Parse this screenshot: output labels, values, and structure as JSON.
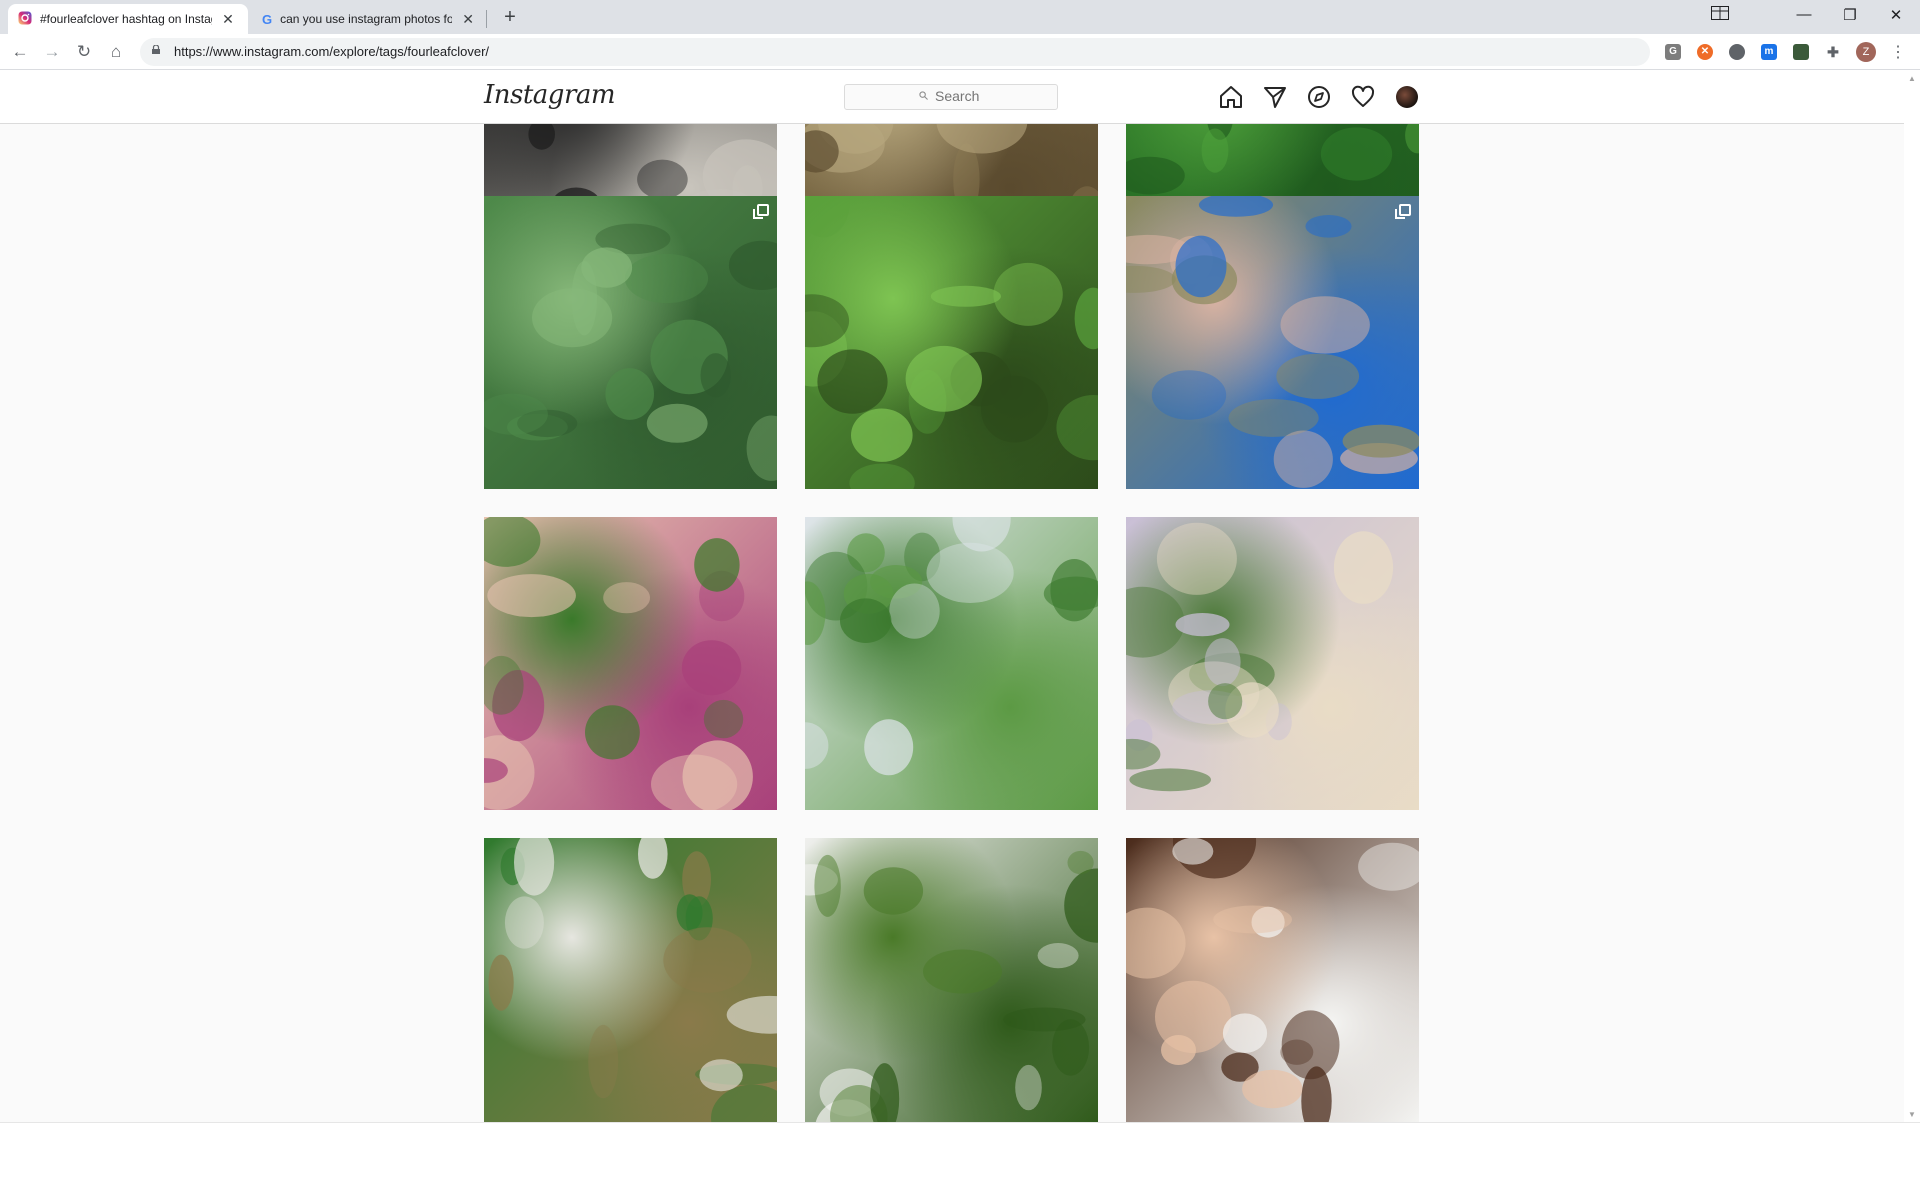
{
  "browser": {
    "tabs": [
      {
        "title": "#fourleafclover hashtag on Instagram",
        "favicon": "instagram-icon",
        "active": true
      },
      {
        "title": "can you use instagram photos for",
        "favicon": "google-icon",
        "active": false
      }
    ],
    "url": "https://www.instagram.com/explore/tags/fourleafclover/",
    "profile_initial": "Z"
  },
  "instagram": {
    "logo": "Instagram",
    "search_placeholder": "Search",
    "nav_icons": [
      "home-icon",
      "direct-icon",
      "explore-icon",
      "activity-heart-icon",
      "profile-avatar"
    ]
  },
  "grid": {
    "rows": [
      [
        {
          "name": "post-partial-1",
          "palette": [
            "#1a1a1a",
            "#2b2b2b",
            "#c9c5bd"
          ],
          "multi": false
        },
        {
          "name": "post-partial-2",
          "palette": [
            "#8c7a52",
            "#b7a77e",
            "#5a4a2e"
          ],
          "multi": false
        },
        {
          "name": "post-partial-3",
          "palette": [
            "#2f7d2a",
            "#4ea03b",
            "#1f5a1e"
          ],
          "multi": false
        }
      ],
      [
        {
          "name": "post-clover-patch",
          "palette": [
            "#4e8a4a",
            "#87b87a",
            "#2f5a2e"
          ],
          "multi": true
        },
        {
          "name": "post-clover-leaves",
          "palette": [
            "#5aa23c",
            "#7ec452",
            "#2c4a1a"
          ],
          "multi": false
        },
        {
          "name": "post-clover-fingers",
          "palette": [
            "#8c8a5e",
            "#d9b3a3",
            "#1f6ad1"
          ],
          "multi": true
        }
      ],
      [
        {
          "name": "post-clovers-in-hand",
          "palette": [
            "#e8c4b0",
            "#3a7a2a",
            "#a8407a"
          ],
          "multi": false
        },
        {
          "name": "post-clovers-on-white",
          "palette": [
            "#dfe5ea",
            "#3c7a2e",
            "#5c9a44"
          ],
          "multi": false
        },
        {
          "name": "post-clover-in-palm",
          "palette": [
            "#c9bfd6",
            "#4d7a3a",
            "#e9dcc6"
          ],
          "multi": false
        }
      ],
      [
        {
          "name": "post-clover-bouquet",
          "palette": [
            "#2f7a2e",
            "#e6e6e0",
            "#8a7a4a"
          ],
          "multi": false
        },
        {
          "name": "post-clover-large-leaf",
          "palette": [
            "#f0f0ee",
            "#4a7a28",
            "#2f5a1a"
          ],
          "multi": false
        },
        {
          "name": "post-clover-pendant",
          "palette": [
            "#4a2a1a",
            "#e8c2a6",
            "#f4f4f2"
          ],
          "multi": false
        }
      ]
    ]
  }
}
